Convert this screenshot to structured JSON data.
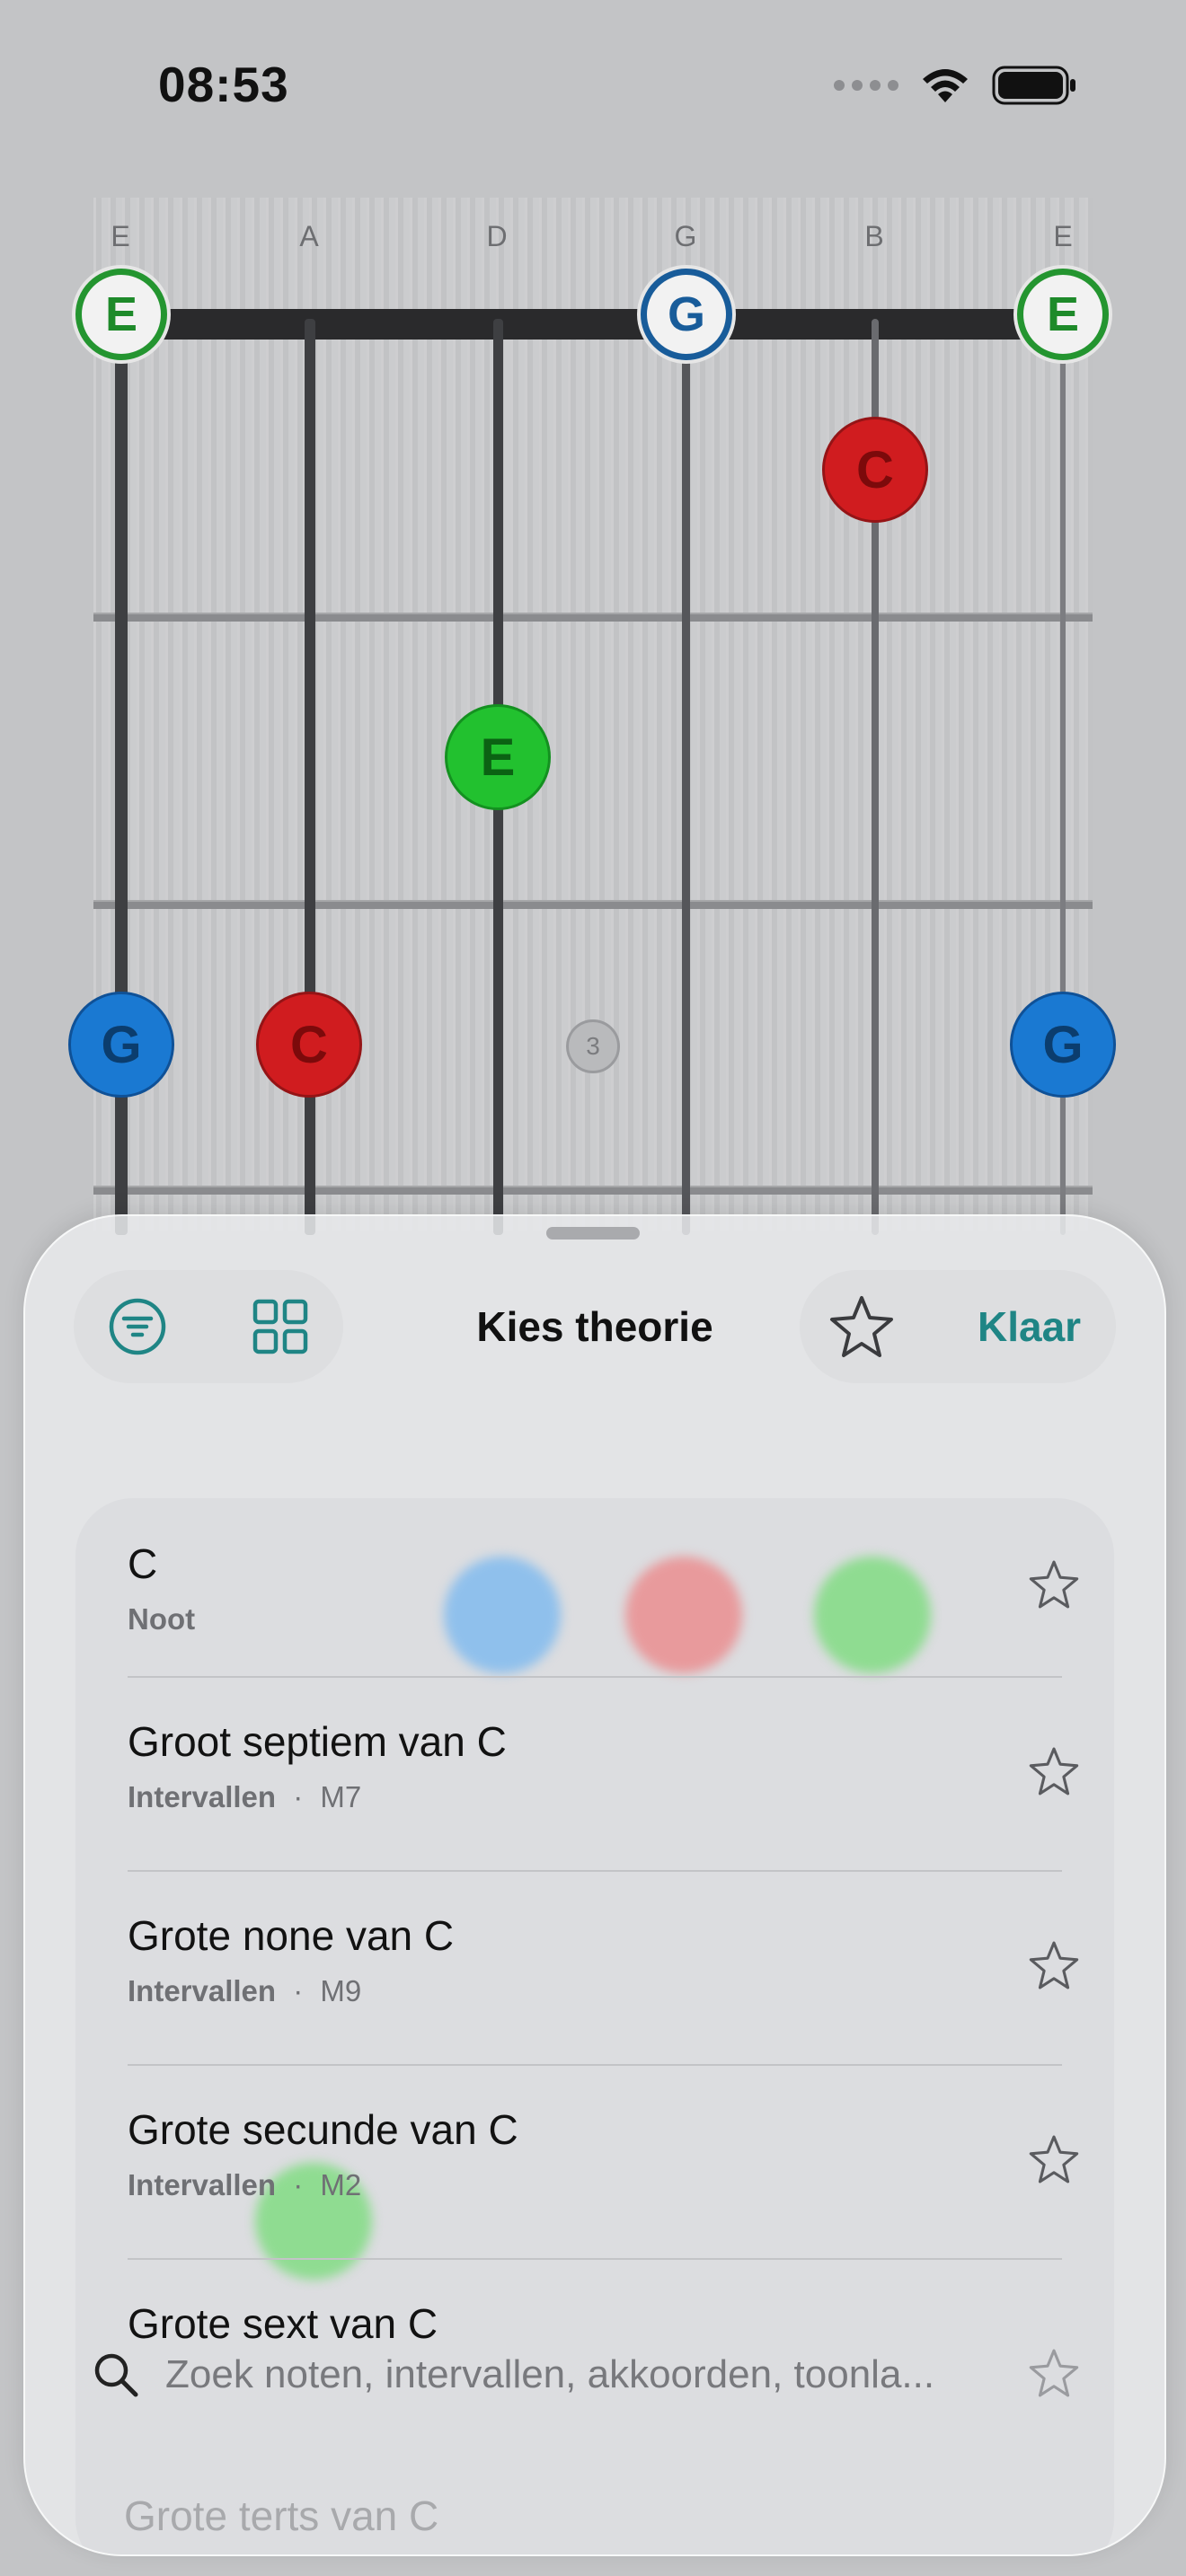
{
  "status_bar": {
    "time": "08:53"
  },
  "fretboard": {
    "strings": [
      "E",
      "A",
      "D",
      "G",
      "B",
      "E"
    ],
    "notes": [
      {
        "label": "E",
        "style": "open-green"
      },
      {
        "label": "G",
        "style": "open-blue"
      },
      {
        "label": "E",
        "style": "open-green"
      },
      {
        "label": "C",
        "style": "red"
      },
      {
        "label": "E",
        "style": "green"
      },
      {
        "label": "G",
        "style": "blue"
      },
      {
        "label": "C",
        "style": "red"
      },
      {
        "label": "G",
        "style": "blue"
      }
    ],
    "fret_marker": "3"
  },
  "sheet": {
    "title": "Kies theorie",
    "done_label": "Klaar",
    "items": [
      {
        "title": "C",
        "category": "Noot",
        "detail": ""
      },
      {
        "title": "Groot septiem van C",
        "category": "Intervallen",
        "detail": "M7"
      },
      {
        "title": "Grote none van C",
        "category": "Intervallen",
        "detail": "M9"
      },
      {
        "title": "Grote secunde van C",
        "category": "Intervallen",
        "detail": "M2"
      },
      {
        "title": "Grote sext van C",
        "category": "",
        "detail": ""
      }
    ],
    "separator": "·",
    "faded_item": "Grote terts van C",
    "search": {
      "placeholder": "Zoek noten, intervallen, akkoorden, toonla..."
    }
  },
  "colors": {
    "accent": "#1f8585",
    "red_note": "#d01c1f",
    "blue_note": "#1a79d2",
    "green_note": "#22c12f"
  }
}
